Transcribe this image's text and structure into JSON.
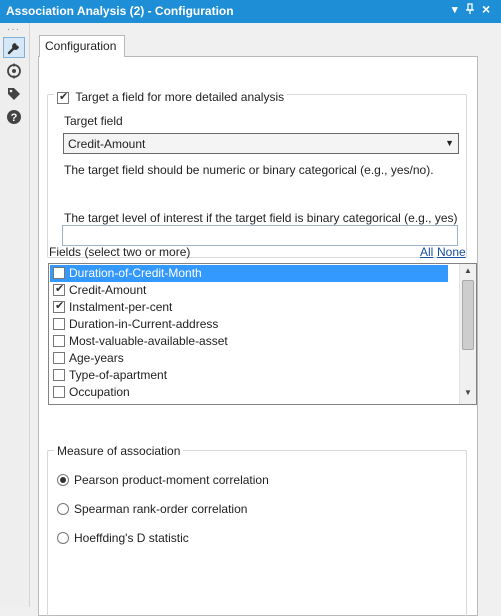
{
  "window": {
    "title": "Association Analysis (2) - Configuration",
    "menu_icon": "▾",
    "pin_icon": "⨠",
    "close_icon": "×"
  },
  "sidebar": {
    "items": [
      {
        "name": "wrench-icon",
        "active": true
      },
      {
        "name": "target-icon",
        "active": false
      },
      {
        "name": "tag-icon",
        "active": false
      },
      {
        "name": "help-icon",
        "active": false
      }
    ]
  },
  "tab": {
    "label": "Configuration"
  },
  "target": {
    "checkbox_label": "Target a field for more detailed analysis",
    "checked": true,
    "field_label": "Target field",
    "field_value": "Credit-Amount",
    "note": "The target field should be numeric or binary categorical (e.g., yes/no).",
    "level_label": "The target level of interest if the target field is binary categorical (e.g., yes)",
    "level_value": ""
  },
  "fields": {
    "label": "Fields (select two or more)",
    "all_link": "All",
    "none_link": "None",
    "items": [
      {
        "label": "Duration-of-Credit-Month",
        "checked": false,
        "selected": true
      },
      {
        "label": "Credit-Amount",
        "checked": true,
        "selected": false
      },
      {
        "label": "Instalment-per-cent",
        "checked": true,
        "selected": false
      },
      {
        "label": "Duration-in-Current-address",
        "checked": false,
        "selected": false
      },
      {
        "label": "Most-valuable-available-asset",
        "checked": false,
        "selected": false
      },
      {
        "label": "Age-years",
        "checked": false,
        "selected": false
      },
      {
        "label": "Type-of-apartment",
        "checked": false,
        "selected": false
      },
      {
        "label": "Occupation",
        "checked": false,
        "selected": false
      }
    ]
  },
  "measure": {
    "legend": "Measure of association",
    "options": [
      {
        "label": "Pearson product-moment correlation",
        "checked": true
      },
      {
        "label": "Spearman rank-order correlation",
        "checked": false
      },
      {
        "label": "Hoeffding's D statistic",
        "checked": false
      }
    ]
  },
  "colors": {
    "titlebar": "#1e8ed6",
    "selection": "#3399ff",
    "link": "#1a4fa0"
  }
}
